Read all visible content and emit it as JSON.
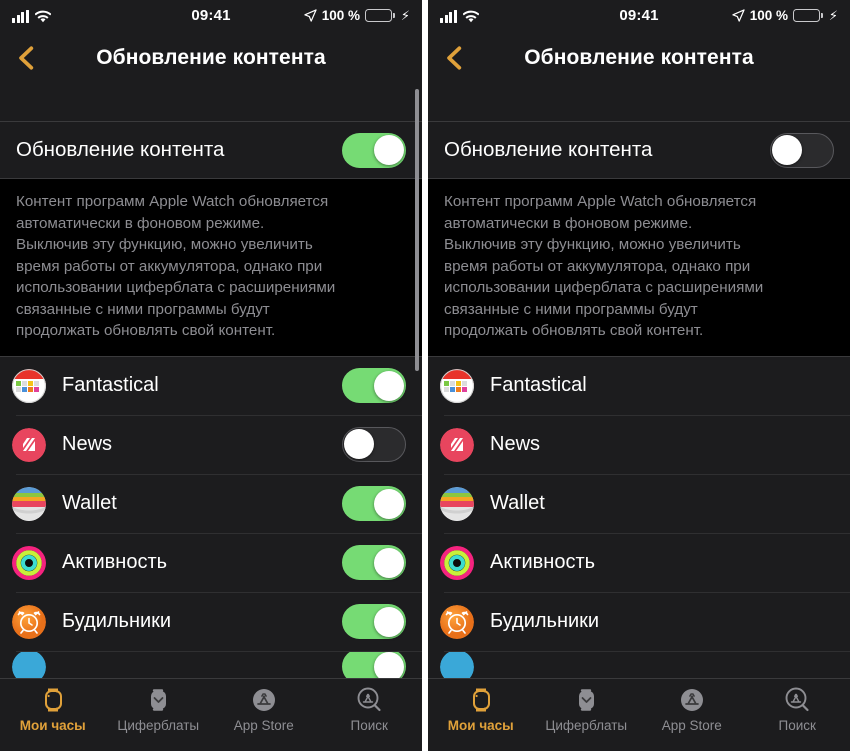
{
  "colors": {
    "bg": "#000000",
    "card": "#1c1c1e",
    "accent": "#e0a13a",
    "switch_on": "#76db74",
    "secondary_text": "#8d8d92",
    "battery": "#4cd964"
  },
  "status_bar": {
    "time": "09:41",
    "battery_percent": "100 %",
    "signal_icon": "cellular-bars-icon",
    "wifi_icon": "wifi-icon",
    "location_icon": "location-arrow-icon",
    "battery_icon": "battery-full-icon",
    "charging_icon": "lightning-bolt-icon"
  },
  "nav": {
    "back_icon": "chevron-left-icon",
    "title": "Обновление контента"
  },
  "master": {
    "label": "Обновление контента",
    "description": "Контент программ Apple Watch обновляется\nавтоматически в фоновом режиме.\nВыключив эту функцию, можно увеличить\nвремя работы от аккумулятора, однако при\nиспользовании циферблата с расширениями\nсвязанные с ними программы будут\nпродолжать обновлять свой контент."
  },
  "panels": {
    "left": {
      "master_enabled": true,
      "master_state_label": "Вкл.",
      "app_switches_visible": true,
      "scrollbar_visible": true,
      "apps": [
        {
          "name": "Fantastical",
          "icon": "fantastical-app-icon",
          "enabled": true,
          "state_label": "Вкл."
        },
        {
          "name": "News",
          "icon": "news-app-icon",
          "enabled": false,
          "state_label": "Выкл."
        },
        {
          "name": "Wallet",
          "icon": "wallet-app-icon",
          "enabled": true,
          "state_label": "Вкл."
        },
        {
          "name": "Активность",
          "icon": "activity-app-icon",
          "enabled": true,
          "state_label": "Вкл."
        },
        {
          "name": "Будильники",
          "icon": "alarms-app-icon",
          "enabled": true,
          "state_label": "Вкл."
        }
      ]
    },
    "right": {
      "master_enabled": false,
      "master_state_label": "Выкл.",
      "app_switches_visible": false,
      "scrollbar_visible": false,
      "apps": [
        {
          "name": "Fantastical",
          "icon": "fantastical-app-icon"
        },
        {
          "name": "News",
          "icon": "news-app-icon"
        },
        {
          "name": "Wallet",
          "icon": "wallet-app-icon"
        },
        {
          "name": "Активность",
          "icon": "activity-app-icon"
        },
        {
          "name": "Будильники",
          "icon": "alarms-app-icon"
        }
      ]
    }
  },
  "tabbar": {
    "items": [
      {
        "label": "Мои часы",
        "icon": "watch-icon",
        "active": true
      },
      {
        "label": "Циферблаты",
        "icon": "watch-face-icon",
        "active": false
      },
      {
        "label": "App Store",
        "icon": "app-store-icon",
        "active": false
      },
      {
        "label": "Поиск",
        "icon": "app-store-search-icon",
        "active": false
      }
    ]
  }
}
